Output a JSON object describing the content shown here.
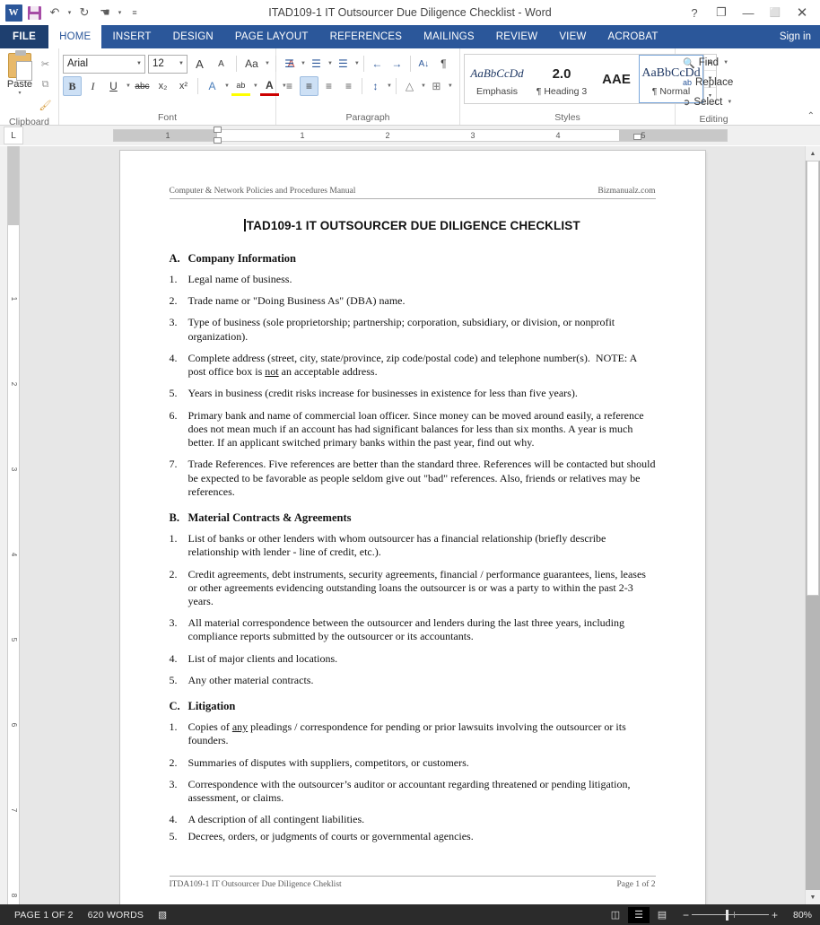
{
  "titlebar": {
    "document_title": "ITAD109-1 IT Outsourcer Due Diligence Checklist - Word",
    "qat": [
      {
        "name": "word-logo-icon",
        "label": "W"
      },
      {
        "name": "save-icon",
        "label": ""
      },
      {
        "name": "undo-icon",
        "label": "↶"
      },
      {
        "name": "undo-dropdown-icon",
        "label": "▾"
      },
      {
        "name": "redo-icon",
        "label": "↻"
      },
      {
        "name": "touch-mode-icon",
        "label": "☚"
      },
      {
        "name": "touch-dropdown-icon",
        "label": "▾"
      },
      {
        "name": "customize-qat-icon",
        "label": "≡"
      }
    ],
    "window_controls": [
      {
        "name": "help-button",
        "label": "?"
      },
      {
        "name": "ribbon-display-options-button",
        "label": "❐"
      },
      {
        "name": "minimize-button",
        "label": "—"
      },
      {
        "name": "restore-button",
        "label": "⬜"
      },
      {
        "name": "close-button",
        "label": "✕"
      }
    ]
  },
  "tabs": {
    "file_label": "FILE",
    "items": [
      {
        "label": "HOME",
        "active": true
      },
      {
        "label": "INSERT",
        "active": false
      },
      {
        "label": "DESIGN",
        "active": false
      },
      {
        "label": "PAGE LAYOUT",
        "active": false
      },
      {
        "label": "REFERENCES",
        "active": false
      },
      {
        "label": "MAILINGS",
        "active": false
      },
      {
        "label": "REVIEW",
        "active": false
      },
      {
        "label": "VIEW",
        "active": false
      },
      {
        "label": "ACROBAT",
        "active": false
      }
    ],
    "signin_label": "Sign in"
  },
  "ribbon": {
    "groups": {
      "clipboard": {
        "label": "Clipboard",
        "paste_label": "Paste",
        "paste_caret": "▾",
        "cut_label": "✂",
        "copy_label": "⧉",
        "format_painter_label": "🖌"
      },
      "font": {
        "label": "Font",
        "font_name": "Arial",
        "font_size": "12",
        "grow_font": "A",
        "shrink_font": "A",
        "change_case": "Aa",
        "clear_formatting": "A",
        "bold": "B",
        "italic": "I",
        "underline": "U",
        "strikethrough": "abc",
        "subscript": "x₂",
        "superscript": "x²",
        "text_effects": "A",
        "highlight": "ab",
        "font_color": "A"
      },
      "paragraph": {
        "label": "Paragraph",
        "bullets": "☰",
        "numbering": "☰",
        "multilevel": "☰",
        "decrease_indent": "←",
        "increase_indent": "→",
        "sort": "A↓",
        "show_marks": "¶",
        "align_left": "≡",
        "align_center": "≡",
        "align_right": "≡",
        "justify": "≡",
        "line_spacing": "↕",
        "shading": "△",
        "borders": "⊞"
      },
      "styles": {
        "label": "Styles",
        "items": [
          {
            "preview": "AaBbCcDd",
            "name": "Emphasis",
            "selected": false
          },
          {
            "preview": "2.0",
            "name": "¶ Heading 3",
            "selected": false
          },
          {
            "preview": "AAE",
            "name": "",
            "selected": false
          },
          {
            "preview": "AaBbCcDd",
            "name": "¶ Normal",
            "selected": true
          }
        ]
      },
      "editing": {
        "label": "Editing",
        "find_label": "Find",
        "find_caret": "▾",
        "replace_label": "Replace",
        "select_label": "Select",
        "select_caret": "▾"
      }
    },
    "collapse_icon": "⌃"
  },
  "ruler": {
    "tab_stop_label": "L",
    "horizontal_numbers": [
      "1",
      "1",
      "2",
      "3",
      "4",
      "5"
    ],
    "vertical_numbers": [
      "1",
      "2",
      "3",
      "4",
      "5",
      "6",
      "7",
      "8"
    ]
  },
  "document": {
    "header_left": "Computer & Network Policies and Procedures Manual",
    "header_right": "Bizmanualz.com",
    "title": "TAD109-1   IT OUTSOURCER DUE DILIGENCE CHECKLIST",
    "sections": [
      {
        "letter": "A.",
        "heading": "Company Information",
        "items": [
          {
            "num": "1.",
            "text": "Legal name of business."
          },
          {
            "num": "2.",
            "text": "Trade name or \"Doing Business As\" (DBA) name."
          },
          {
            "num": "3.",
            "text": "Type of business (sole proprietorship; partnership; corporation, subsidiary, or division, or nonprofit organization)."
          },
          {
            "num": "4.",
            "text": "Complete address (street, city, state/province, zip code/postal code) and telephone number(s).  NOTE: A post office box is not an acceptable address."
          },
          {
            "num": "5.",
            "text": "Years in business (credit risks increase for businesses in existence for less than five years)."
          },
          {
            "num": "6.",
            "text": "Primary bank and name of commercial loan officer. Since money can be moved around easily, a reference does not mean much if an account has had significant balances for less than six months.  A year is much better. If an applicant switched primary banks within the past year, find out why."
          },
          {
            "num": "7.",
            "text": "Trade References.  Five references are better than the standard three.  References will be contacted but should be expected to be favorable as people seldom give out \"bad\" references.  Also, friends or relatives may be references."
          }
        ]
      },
      {
        "letter": "B.",
        "heading": "Material Contracts & Agreements",
        "items": [
          {
            "num": "1.",
            "text": "List of banks or other lenders with whom outsourcer has a financial relationship (briefly describe relationship with lender - line of credit, etc.)."
          },
          {
            "num": "2.",
            "text": "Credit agreements, debt instruments, security agreements, financial / performance guarantees, liens, leases or other agreements evidencing outstanding loans the outsourcer is or was a party to within the past 2-3 years."
          },
          {
            "num": "3.",
            "text": "All material correspondence between the outsourcer and lenders during the last three years, including compliance reports submitted by the outsourcer or its accountants."
          },
          {
            "num": "4.",
            "text": "List of major clients and locations."
          },
          {
            "num": "5.",
            "text": "Any other material contracts."
          }
        ]
      },
      {
        "letter": "C.",
        "heading": "Litigation",
        "items": [
          {
            "num": "1.",
            "text": "Copies of any pleadings / correspondence for pending or prior lawsuits involving the outsourcer or its founders."
          },
          {
            "num": "2.",
            "text": "Summaries of disputes with suppliers, competitors, or customers."
          },
          {
            "num": "3.",
            "text": "Correspondence with the outsourcer’s auditor or accountant regarding threatened or pending litigation, assessment, or claims."
          },
          {
            "num": "4.",
            "text": "A description of all contingent liabilities."
          },
          {
            "num": "5.",
            "text": "Decrees, orders, or judgments of courts or governmental agencies."
          }
        ]
      }
    ],
    "footer_left": "ITDA109-1 IT Outsourcer Due Diligence Cheklist",
    "footer_right": "Page 1 of 2"
  },
  "statusbar": {
    "page_label": "PAGE 1 OF 2",
    "word_count": "620 WORDS",
    "proofing_icon": "▧",
    "views": [
      {
        "name": "read-mode-view-button",
        "glyph": "◫",
        "active": false
      },
      {
        "name": "print-layout-view-button",
        "glyph": "☰",
        "active": true
      },
      {
        "name": "web-layout-view-button",
        "glyph": "▤",
        "active": false
      }
    ],
    "zoom_out": "−",
    "zoom_in": "+",
    "zoom_level": "80%"
  },
  "colors": {
    "ribbon_accent": "#2b579a",
    "file_tab": "#1e3f6f",
    "status_bar": "#2b2b2b",
    "workspace_bg": "#e7e7e7",
    "selection_blue": "#cde0f5"
  }
}
